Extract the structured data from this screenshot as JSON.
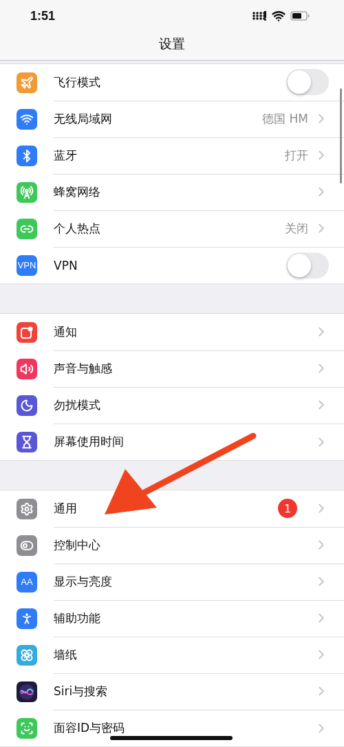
{
  "status_bar": {
    "time": "1:51"
  },
  "title": "设置",
  "groups": [
    {
      "rows": [
        {
          "label": "飞行模式",
          "kind": "toggle",
          "on": false
        },
        {
          "label": "无线局域网",
          "kind": "detail",
          "value": "德国 HM"
        },
        {
          "label": "蓝牙",
          "kind": "detail",
          "value": "打开"
        },
        {
          "label": "蜂窝网络",
          "kind": "detail"
        },
        {
          "label": "个人热点",
          "kind": "detail",
          "value": "关闭"
        },
        {
          "label": "VPN",
          "kind": "toggle",
          "on": false,
          "icon_text": "VPN"
        }
      ]
    },
    {
      "rows": [
        {
          "label": "通知",
          "kind": "detail"
        },
        {
          "label": "声音与触感",
          "kind": "detail"
        },
        {
          "label": "勿扰模式",
          "kind": "detail"
        },
        {
          "label": "屏幕使用时间",
          "kind": "detail"
        }
      ]
    },
    {
      "rows": [
        {
          "label": "通用",
          "kind": "detail",
          "badge": "1"
        },
        {
          "label": "控制中心",
          "kind": "detail"
        },
        {
          "label": "显示与亮度",
          "kind": "detail",
          "icon_text": "AA"
        },
        {
          "label": "辅助功能",
          "kind": "detail"
        },
        {
          "label": "墙纸",
          "kind": "detail"
        },
        {
          "label": "Siri与搜索",
          "kind": "detail"
        },
        {
          "label": "面容ID与密码",
          "kind": "detail"
        }
      ]
    }
  ]
}
